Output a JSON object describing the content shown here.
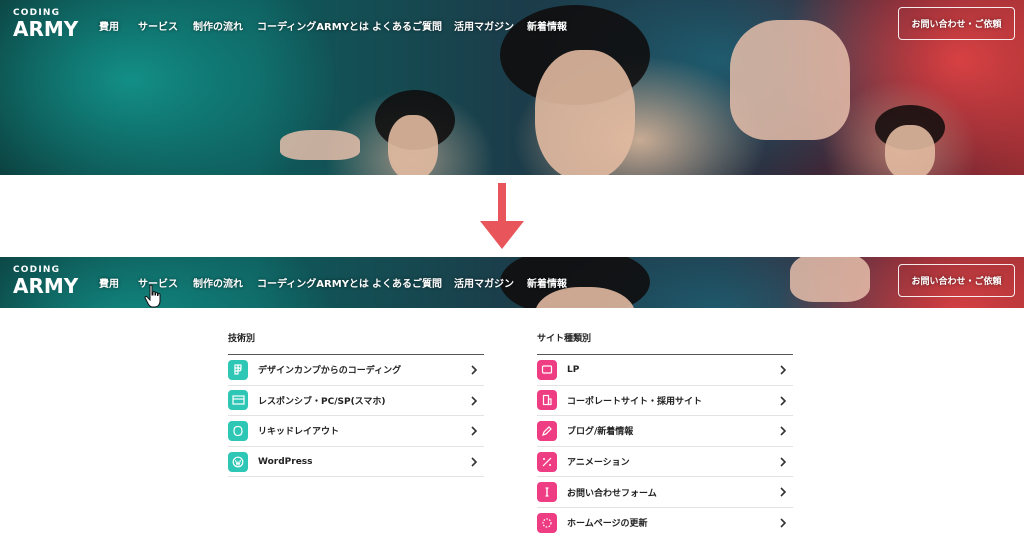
{
  "brand": {
    "logo_line1": "CODING",
    "logo_line2": "ARMY"
  },
  "nav": {
    "items": [
      {
        "label": "費用"
      },
      {
        "label": "サービス"
      },
      {
        "label": "制作の流れ"
      },
      {
        "label": "コーディングARMYとは"
      },
      {
        "label": "よくあるご質問"
      },
      {
        "label": "活用マガジン"
      },
      {
        "label": "新着情報"
      }
    ],
    "contact_label": "お問い合わせ・ご依頼"
  },
  "annotation": {
    "arrow_color": "#e8555a"
  },
  "dropdown": {
    "left": {
      "heading": "技術別",
      "items": [
        {
          "label": "デザインカンプからのコーディング",
          "icon": "figma-icon"
        },
        {
          "label": "レスポンシブ・PC/SP(スマホ)",
          "icon": "responsive-icon"
        },
        {
          "label": "リキッドレイアウト",
          "icon": "liquid-icon"
        },
        {
          "label": "WordPress",
          "icon": "wordpress-icon"
        }
      ]
    },
    "right": {
      "heading": "サイト種類別",
      "items": [
        {
          "label": "LP",
          "icon": "monitor-icon"
        },
        {
          "label": "コーポレートサイト・採用サイト",
          "icon": "building-icon"
        },
        {
          "label": "ブログ/新着情報",
          "icon": "pen-icon"
        },
        {
          "label": "アニメーション",
          "icon": "animation-icon"
        },
        {
          "label": "お問い合わせフォーム",
          "icon": "form-icon"
        },
        {
          "label": "ホームページの更新",
          "icon": "update-icon"
        }
      ]
    }
  },
  "colors": {
    "teal": "#2ec7b6",
    "pink": "#ee3d83",
    "text": "#222222"
  }
}
